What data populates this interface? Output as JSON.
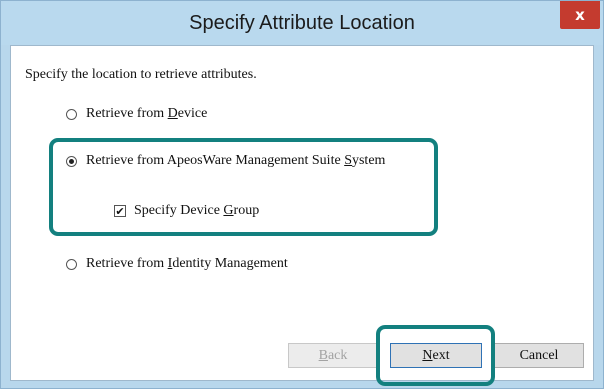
{
  "window": {
    "title": "Specify Attribute Location",
    "close_glyph": "x"
  },
  "instruction": "Specify the location to retrieve attributes.",
  "options": {
    "device": {
      "prefix": "Retrieve from ",
      "key": "D",
      "suffix": "evice",
      "selected": false
    },
    "apeosware": {
      "prefix": "Retrieve from ApeosWare Management Suite ",
      "key": "S",
      "suffix": "ystem",
      "selected": true
    },
    "identity": {
      "prefix": "Retrieve from ",
      "key": "I",
      "suffix": "dentity Management",
      "selected": false
    }
  },
  "device_group": {
    "prefix": "Specify Device ",
    "key": "G",
    "suffix": "roup",
    "checked": true,
    "check_glyph": "✔"
  },
  "buttons": {
    "back": {
      "key": "B",
      "suffix": "ack",
      "enabled": false
    },
    "next": {
      "key": "N",
      "suffix": "ext",
      "enabled": true
    },
    "cancel": {
      "label": "Cancel",
      "enabled": true
    }
  },
  "colors": {
    "highlight": "#13807f",
    "titlebar": "#b9d9ee",
    "close": "#c43b2f"
  }
}
